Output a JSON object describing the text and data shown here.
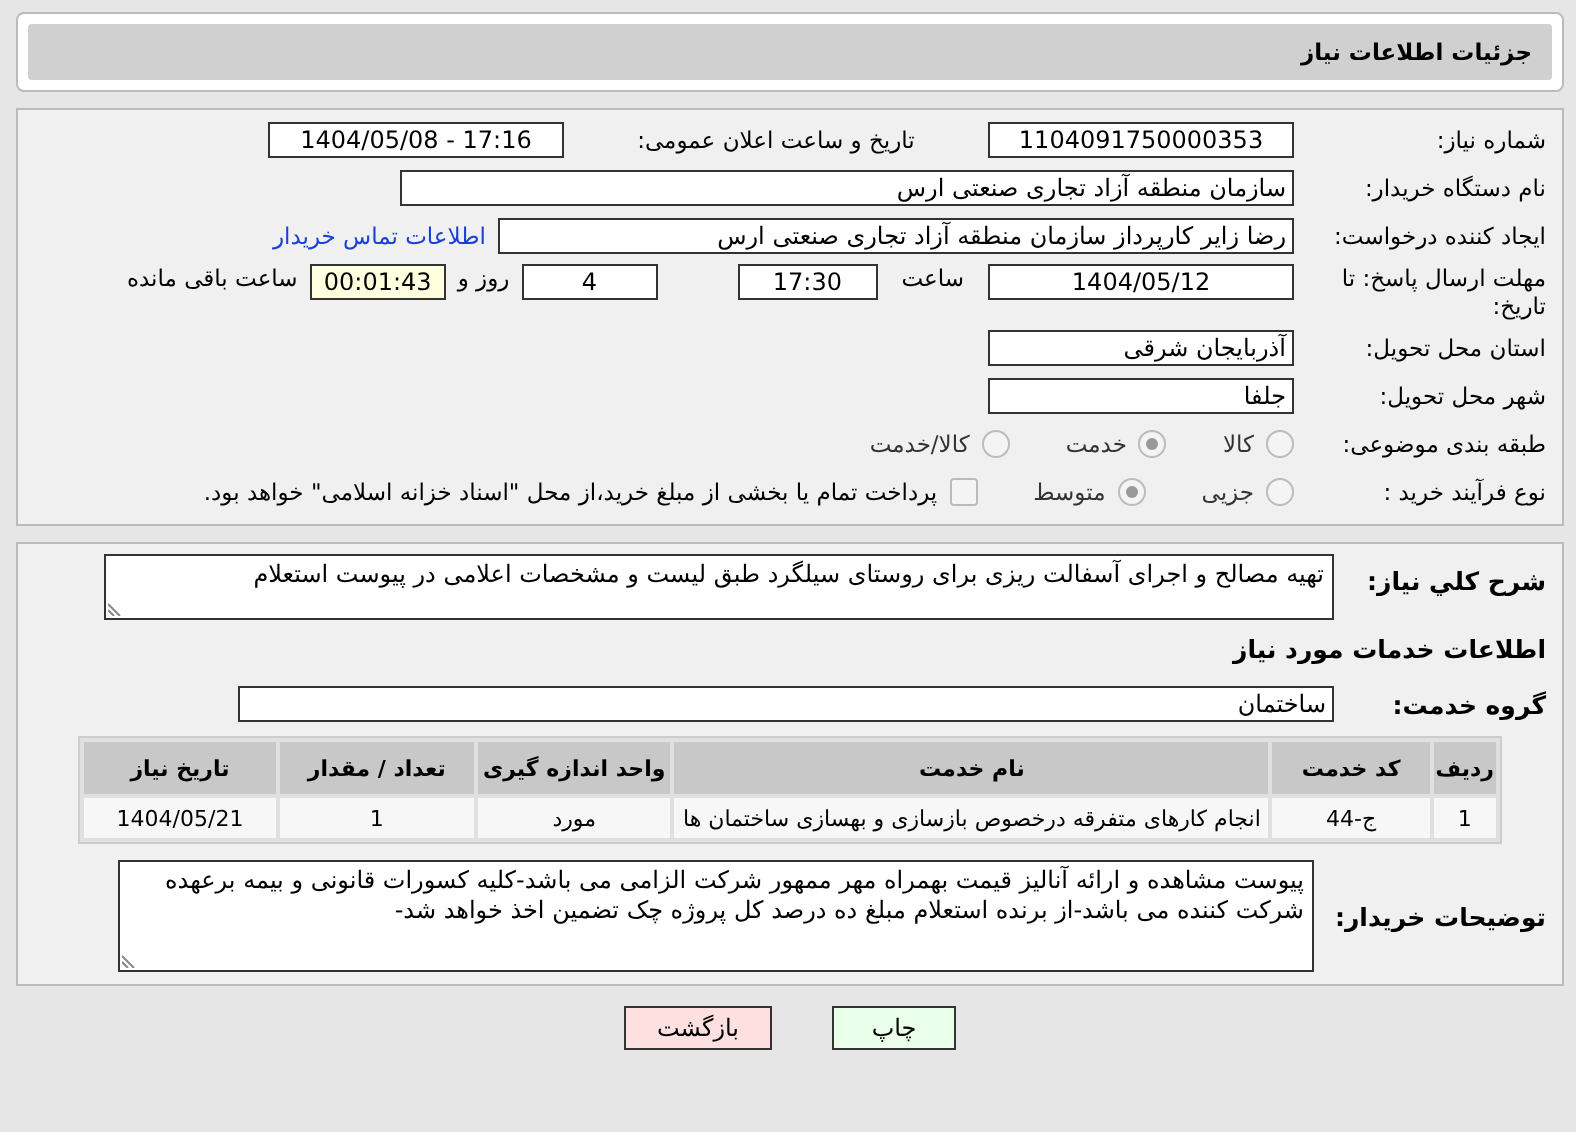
{
  "header": {
    "title": "جزئیات اطلاعات نیاز"
  },
  "need_number": {
    "label": "شماره نیاز:",
    "value": "1104091750000353"
  },
  "announce": {
    "label": "تاريخ و ساعت اعلان عمومی:",
    "value": "1404/05/08 - 17:16"
  },
  "buyer_org": {
    "label": "نام دستگاه خریدار:",
    "value": "سازمان منطقه آزاد تجاری صنعتی ارس"
  },
  "requester": {
    "label": "ایجاد کننده درخواست:",
    "value": "رضا زایر کارپرداز سازمان منطقه آزاد تجاری صنعتی ارس",
    "link": "اطلاعات تماس خریدار"
  },
  "deadline": {
    "label": "مهلت ارسال پاسخ: تا تاریخ:",
    "date": "1404/05/12",
    "time_label": "ساعت",
    "time": "17:30",
    "days": "4",
    "days_label": "روز و",
    "remaining": "00:01:43",
    "remaining_label": "ساعت باقی مانده"
  },
  "province": {
    "label": "استان محل تحویل:",
    "value": "آذربایجان شرقی"
  },
  "city": {
    "label": "شهر محل تحویل:",
    "value": "جلفا"
  },
  "category": {
    "label": "طبقه بندی موضوعی:",
    "options": [
      {
        "label": "کالا",
        "selected": false
      },
      {
        "label": "خدمت",
        "selected": true
      },
      {
        "label": "کالا/خدمت",
        "selected": false
      }
    ]
  },
  "purchase_type": {
    "label": "نوع فرآیند خرید :",
    "options": [
      {
        "label": "جزیی",
        "selected": false
      },
      {
        "label": "متوسط",
        "selected": true
      }
    ],
    "payment_note": {
      "label": "پرداخت تمام یا بخشی از مبلغ خرید،از محل \"اسناد خزانه اسلامی\" خواهد بود.",
      "checked": false
    }
  },
  "description": {
    "label": "شرح کلي نياز:",
    "value": "تهیه مصالح و اجرای آسفالت ریزی برای روستای سیلگرد طبق لیست و مشخصات اعلامی در پیوست استعلام"
  },
  "services_title": "اطلاعات خدمات مورد نياز",
  "service_group": {
    "label": "گروه خدمت:",
    "value": "ساختمان"
  },
  "table": {
    "columns": [
      "ردیف",
      "کد خدمت",
      "نام خدمت",
      "واحد اندازه گیری",
      "تعداد / مقدار",
      "تاریخ نیاز"
    ],
    "rows": [
      [
        "1",
        "ج-44",
        "انجام کارهای متفرقه درخصوص بازسازی و بهسازی ساختمان ها",
        "مورد",
        "1",
        "1404/05/21"
      ]
    ]
  },
  "buyer_notes": {
    "label": "توضیحات خریدار:",
    "value": "پیوست مشاهده و ارائه آنالیز قیمت بهمراه مهر ممهور شرکت الزامی می باشد-کلیه کسورات قانونی و بیمه برعهده شرکت کننده می باشد-از برنده استعلام مبلغ ده درصد کل پروژه چک تضمین اخذ خواهد شد-"
  },
  "buttons": [
    {
      "label": "چاپ",
      "kind": "print"
    },
    {
      "label": "بازگشت",
      "kind": "back"
    }
  ]
}
